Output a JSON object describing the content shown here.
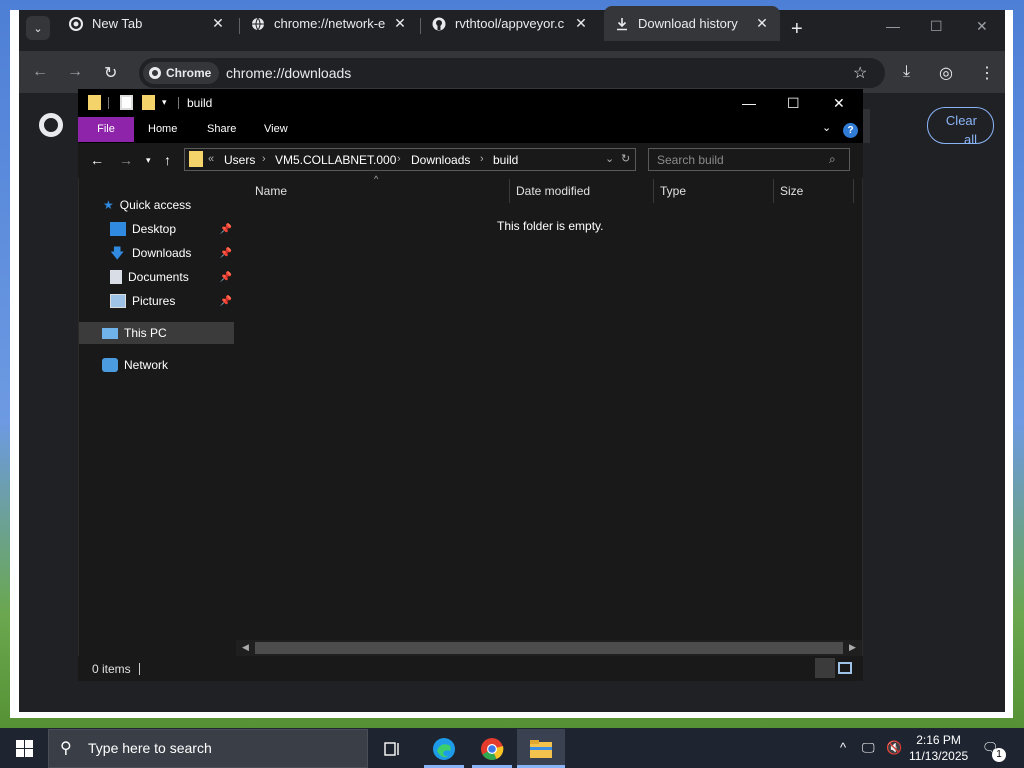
{
  "chrome": {
    "tabs": [
      {
        "title": "New Tab",
        "favicon": "chrome-icon"
      },
      {
        "title": "chrome://network-e",
        "favicon": "globe-icon"
      },
      {
        "title": "rvthtool/appveyor.c",
        "favicon": "github-icon"
      },
      {
        "title": "Download history",
        "favicon": "download-icon",
        "active": true
      }
    ],
    "omnibox": {
      "chip_label": "Chrome",
      "url": "chrome://downloads"
    },
    "downloads_page": {
      "clear_all_line1": "Clear",
      "clear_all_line2": "all"
    }
  },
  "explorer": {
    "title": "build",
    "ribbon_tabs": [
      "File",
      "Home",
      "Share",
      "View"
    ],
    "breadcrumb": [
      "Users",
      "VM5.COLLABNET.000",
      "Downloads",
      "build"
    ],
    "breadcrumb_overflow": "«",
    "search_placeholder": "Search build",
    "nav": {
      "quick_access": "Quick access",
      "items": [
        "Desktop",
        "Downloads",
        "Documents",
        "Pictures"
      ],
      "this_pc": "This PC",
      "network": "Network"
    },
    "columns": [
      "Name",
      "Date modified",
      "Type",
      "Size"
    ],
    "empty_message": "This folder is empty.",
    "status": "0 items",
    "accent_color": "#8e24aa"
  },
  "taskbar": {
    "search_placeholder": "Type here to search",
    "time": "2:16 PM",
    "date": "11/13/2025",
    "notification_count": "1"
  }
}
